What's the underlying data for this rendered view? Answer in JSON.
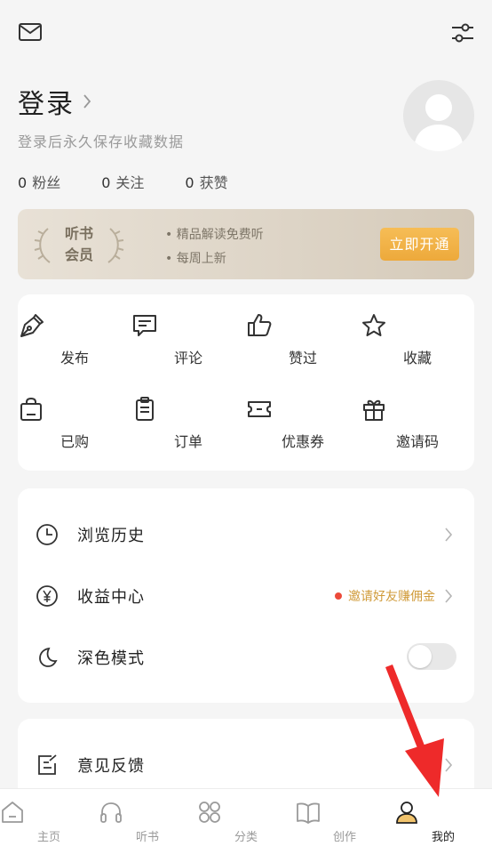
{
  "header": {
    "mail_icon": "mail-icon",
    "settings_icon": "sliders-icon"
  },
  "profile": {
    "login_title": "登录",
    "login_sub": "登录后永久保存收藏数据",
    "stats": [
      {
        "num": "0",
        "label": "粉丝"
      },
      {
        "num": "0",
        "label": "关注"
      },
      {
        "num": "0",
        "label": "获赞"
      }
    ]
  },
  "vip": {
    "label_line1": "听书",
    "label_line2": "会员",
    "feature1": "• 精品解读免费听",
    "feature2": "• 每周上新",
    "button": "立即开通"
  },
  "grid": [
    {
      "label": "发布",
      "icon": "pen-icon"
    },
    {
      "label": "评论",
      "icon": "comment-icon"
    },
    {
      "label": "赞过",
      "icon": "thumbs-up-icon"
    },
    {
      "label": "收藏",
      "icon": "star-icon"
    },
    {
      "label": "已购",
      "icon": "shopping-bag-icon"
    },
    {
      "label": "订单",
      "icon": "clipboard-icon"
    },
    {
      "label": "优惠券",
      "icon": "ticket-icon"
    },
    {
      "label": "邀请码",
      "icon": "gift-icon"
    }
  ],
  "list": {
    "history": "浏览历史",
    "income": "收益中心",
    "income_promo": "邀请好友赚佣金",
    "dark_mode": "深色模式",
    "dark_mode_on": false,
    "feedback": "意见反馈"
  },
  "tabs": [
    {
      "label": "主页",
      "icon": "home-icon"
    },
    {
      "label": "听书",
      "icon": "headphones-icon"
    },
    {
      "label": "分类",
      "icon": "category-icon"
    },
    {
      "label": "创作",
      "icon": "book-icon"
    },
    {
      "label": "我的",
      "icon": "user-icon",
      "active": true
    }
  ],
  "colors": {
    "accent": "#eda93b",
    "promo_text": "#d09b3a",
    "promo_dot": "#ec4a3a",
    "annotation_arrow": "#ee2a2a"
  }
}
